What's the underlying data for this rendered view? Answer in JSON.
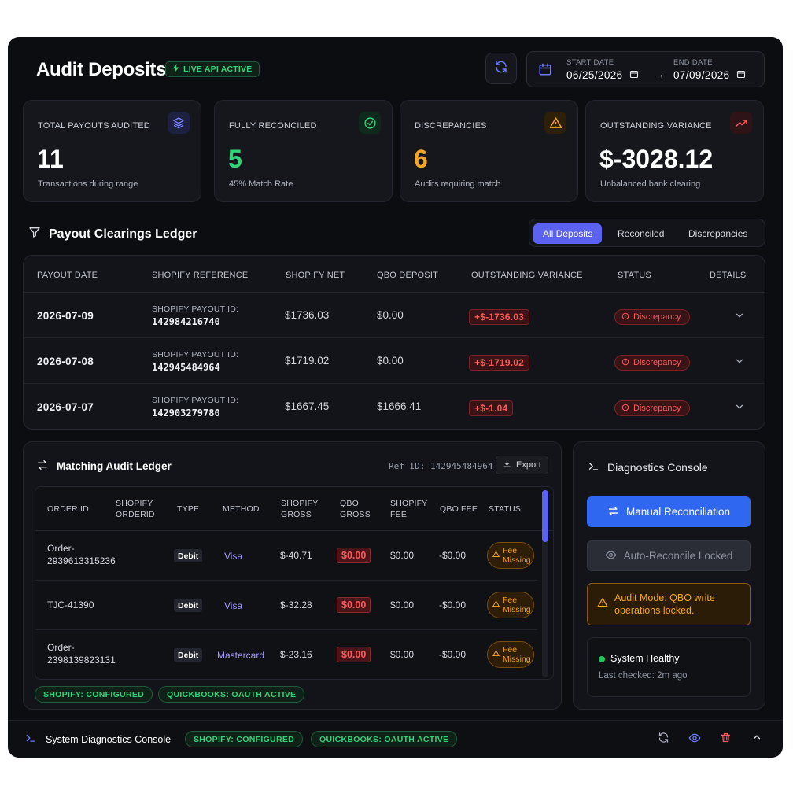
{
  "header": {
    "title": "Audit Deposits",
    "live_badge": "LIVE API ACTIVE",
    "start_label": "START DATE",
    "start_value": "06/25/2026",
    "end_label": "END DATE",
    "end_value": "07/09/2026"
  },
  "stats": [
    {
      "label": "TOTAL PAYOUTS AUDITED",
      "value": "11",
      "sub": "Transactions during range",
      "icon": "layers-icon",
      "color": "#ffffff"
    },
    {
      "label": "FULLY RECONCILED",
      "value": "5",
      "sub": "45% Match Rate",
      "icon": "check-circle-icon",
      "color": "#34d37a"
    },
    {
      "label": "DISCREPANCIES",
      "value": "6",
      "sub": "Audits requiring match",
      "icon": "warning-icon",
      "color": "#f5a623"
    },
    {
      "label": "OUTSTANDING VARIANCE",
      "value": "$-3028.12",
      "sub": "Unbalanced bank clearing",
      "icon": "trending-up-icon",
      "color": "#ffffff"
    }
  ],
  "ledger": {
    "title": "Payout Clearings Ledger",
    "tabs": [
      "All Deposits",
      "Reconciled",
      "Discrepancies"
    ],
    "active_tab": "All Deposits",
    "columns": [
      "PAYOUT DATE",
      "SHOPIFY REFERENCE",
      "SHOPIFY NET",
      "QBO DEPOSIT",
      "OUTSTANDING VARIANCE",
      "STATUS",
      "DETAILS"
    ],
    "rows": [
      {
        "date": "2026-07-09",
        "ref_label": "SHOPIFY PAYOUT ID:",
        "ref_id": "142984216740",
        "net": "$1736.03",
        "qbo": "$0.00",
        "variance": "+$-1736.03",
        "status": "Discrepancy"
      },
      {
        "date": "2026-07-08",
        "ref_label": "SHOPIFY PAYOUT ID:",
        "ref_id": "142945484964",
        "net": "$1719.02",
        "qbo": "$0.00",
        "variance": "+$-1719.02",
        "status": "Discrepancy"
      },
      {
        "date": "2026-07-07",
        "ref_label": "SHOPIFY PAYOUT ID:",
        "ref_id": "142903279780",
        "net": "$1667.45",
        "qbo": "$1666.41",
        "variance": "+$-1.04",
        "status": "Discrepancy"
      }
    ]
  },
  "matching": {
    "title": "Matching Audit Ledger",
    "ref_id": "Ref ID: 142945484964",
    "export_label": "Export",
    "columns": {
      "order_id": "ORDER ID",
      "shopify_orderid": [
        "SHOPIFY",
        "ORDERID"
      ],
      "type": "TYPE",
      "method": "METHOD",
      "shopify_gross": [
        "SHOPIFY",
        "GROSS"
      ],
      "qbo_gross": [
        "QBO",
        "GROSS"
      ],
      "shopify_fee": [
        "SHOPIFY",
        "FEE"
      ],
      "qbo_fee": "QBO FEE",
      "status": "STATUS"
    },
    "rows": [
      {
        "order_id": [
          "Order-",
          "2939613315236"
        ],
        "type": "Debit",
        "method": "Visa",
        "shopify_gross": "$-40.71",
        "qbo_gross": "$0.00",
        "shopify_fee": "$0.00",
        "qbo_fee": "-$0.00",
        "status": [
          "Fee",
          "Missing"
        ]
      },
      {
        "order_id": [
          "TJC-41390"
        ],
        "type": "Debit",
        "method": "Visa",
        "shopify_gross": "$-32.28",
        "qbo_gross": "$0.00",
        "shopify_fee": "$0.00",
        "qbo_fee": "-$0.00",
        "status": [
          "Fee",
          "Missing"
        ]
      },
      {
        "order_id": [
          "Order-",
          "2398139823131"
        ],
        "type": "Debit",
        "method": "Mastercard",
        "shopify_gross": "$-23.16",
        "qbo_gross": "$0.00",
        "shopify_fee": "$0.00",
        "qbo_fee": "-$0.00",
        "status": [
          "Fee",
          "Missing"
        ]
      }
    ],
    "pills": [
      "SHOPIFY: CONFIGURED",
      "QUICKBOOKS: OAUTH ACTIVE"
    ]
  },
  "diagnostics": {
    "title": "Diagnostics Console",
    "manual_label": "Manual Reconciliation",
    "locked_label": "Auto-Reconcile Locked",
    "warning": "Audit Mode: QBO write operations locked.",
    "health_title": "System Healthy",
    "health_sub": "Last checked: 2m ago"
  },
  "bottombar": {
    "title": "System Diagnostics Console",
    "pills": [
      "SHOPIFY: CONFIGURED",
      "QUICKBOOKS: OAUTH ACTIVE"
    ]
  },
  "colors": {
    "accent": "#5b62f0",
    "primary_button": "#2f67f0",
    "success": "#34d37a",
    "danger": "#ff5a5a",
    "warning": "#f5a623"
  }
}
